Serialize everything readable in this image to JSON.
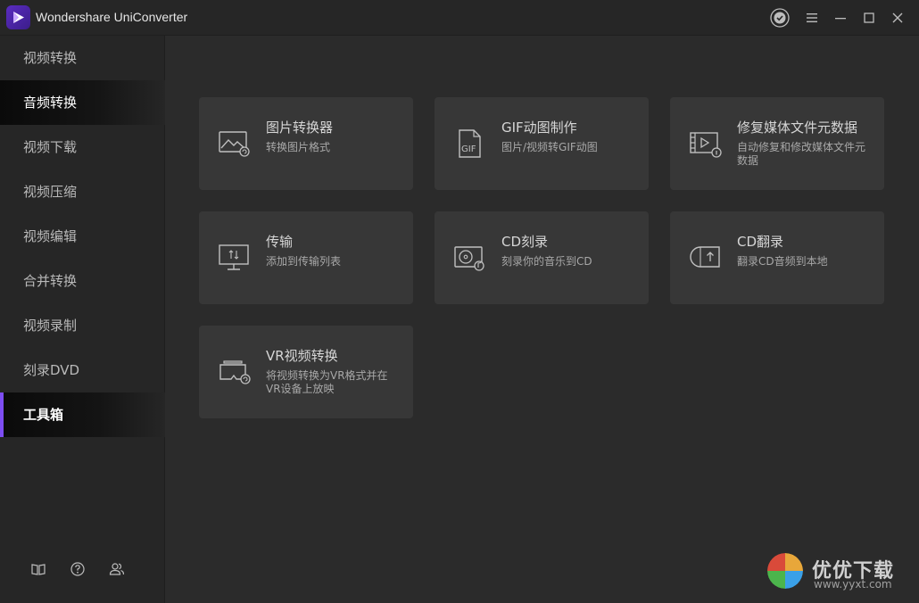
{
  "app": {
    "title": "Wondershare UniConverter"
  },
  "sidebar": {
    "items": [
      {
        "label": "视频转换"
      },
      {
        "label": "音频转换"
      },
      {
        "label": "视频下载"
      },
      {
        "label": "视频压缩"
      },
      {
        "label": "视频编辑"
      },
      {
        "label": "合并转换"
      },
      {
        "label": "视频录制"
      },
      {
        "label": "刻录DVD"
      },
      {
        "label": "工具箱"
      }
    ],
    "hovered": "音频转换",
    "active": "工具箱"
  },
  "tools": [
    {
      "title": "图片转换器",
      "desc": "转换图片格式",
      "icon": "image-convert-icon"
    },
    {
      "title": "GIF动图制作",
      "desc": "图片/视频转GIF动图",
      "icon": "gif-icon"
    },
    {
      "title": "修复媒体文件元数据",
      "desc": "自动修复和修改媒体文件元数据",
      "icon": "metadata-icon"
    },
    {
      "title": "传输",
      "desc": "添加到传输列表",
      "icon": "transfer-icon"
    },
    {
      "title": "CD刻录",
      "desc": "刻录你的音乐到CD",
      "icon": "cd-burn-icon"
    },
    {
      "title": "CD翻录",
      "desc": "翻录CD音频到本地",
      "icon": "cd-rip-icon"
    },
    {
      "title": "VR视频转换",
      "desc": "将视频转换为VR格式并在VR设备上放映",
      "icon": "vr-icon"
    }
  ],
  "watermark": {
    "name": "优优下载",
    "url": "www.yyxt.com"
  },
  "colors": {
    "accent": "#7d4df2",
    "card": "#373737",
    "background": "#2b2b2b",
    "sidebar": "#262626"
  }
}
